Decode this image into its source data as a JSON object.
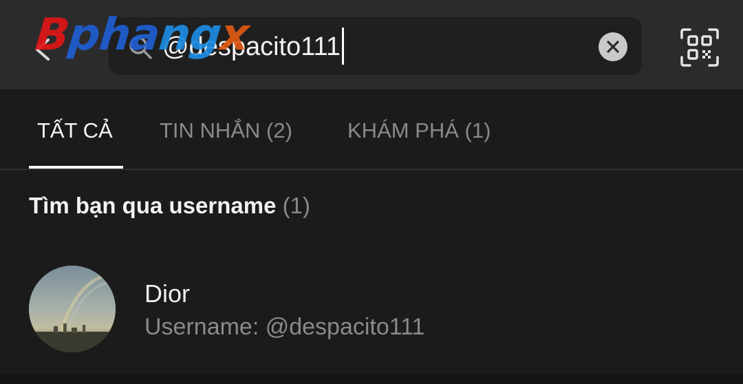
{
  "watermark": {
    "text": "Bphangx"
  },
  "header": {
    "back_icon": "back-arrow-icon",
    "search": {
      "icon": "search-icon",
      "value": "@despacito111",
      "clear_icon": "close-icon"
    },
    "qr_icon": "qr-scan-icon"
  },
  "tabs": [
    {
      "label": "TẤT CẢ",
      "active": true
    },
    {
      "label": "TIN NHẮN (2)",
      "active": false
    },
    {
      "label": "KHÁM PHÁ (1)",
      "active": false
    }
  ],
  "section": {
    "title": "Tìm bạn qua username",
    "count": "(1)"
  },
  "results": [
    {
      "name": "Dior",
      "subtitle": "Username: @despacito111"
    }
  ],
  "colors": {
    "background": "#1b1b1c",
    "header": "#2b2b2c",
    "text_primary": "#f2f2f2",
    "text_secondary": "#8a8a8d"
  }
}
